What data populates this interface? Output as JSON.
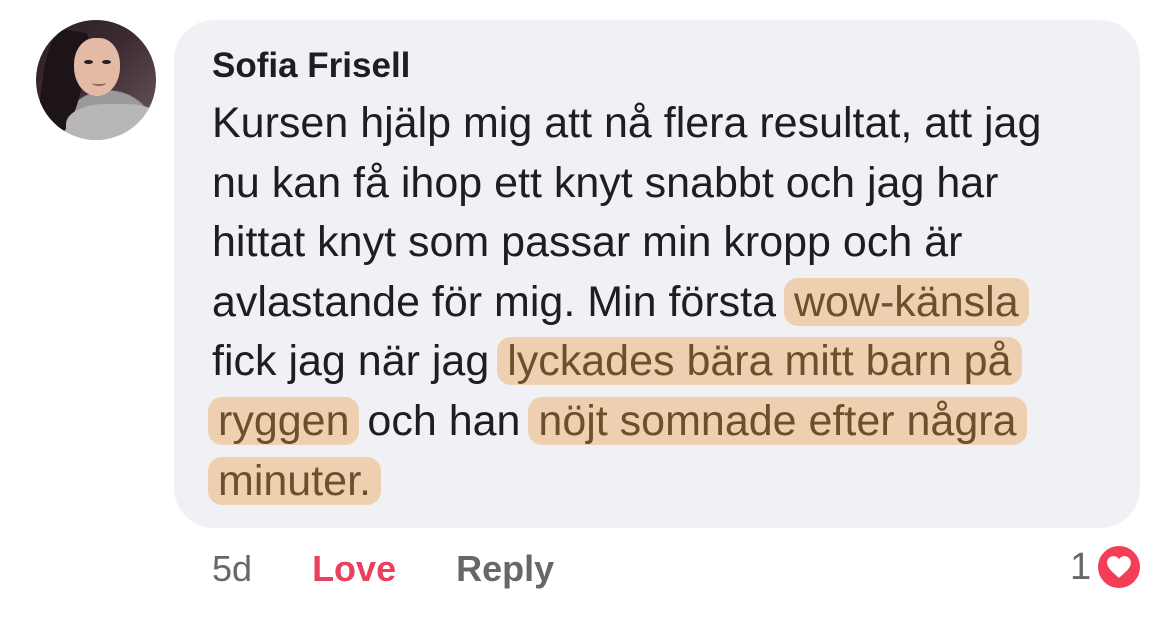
{
  "comment": {
    "author": "Sofia Frisell",
    "lines": [
      [
        {
          "t": "Kursen hjälp mig att nå flera resultat, att jag",
          "h": false
        }
      ],
      [
        {
          "t": "nu kan få ihop ett knyt snabbt och jag har",
          "h": false
        }
      ],
      [
        {
          "t": "hittat knyt som passar min kropp och är",
          "h": false
        }
      ],
      [
        {
          "t": "avlastande för mig. Min första ",
          "h": false
        },
        {
          "t": "wow-känsla",
          "h": true
        }
      ],
      [
        {
          "t": "fick jag när jag ",
          "h": false
        },
        {
          "t": "lyckades bära mitt barn på",
          "h": true
        }
      ],
      [
        {
          "t": "ryggen",
          "h": true
        },
        {
          "t": " och han ",
          "h": false
        },
        {
          "t": "nöjt somnade efter några",
          "h": true
        }
      ],
      [
        {
          "t": "minuter.",
          "h": true
        }
      ]
    ],
    "highlight_color": "#ecb278"
  },
  "actions": {
    "time": "5d",
    "love_label": "Love",
    "reply_label": "Reply",
    "love_color": "#e9405e"
  },
  "reactions": {
    "count": "1",
    "icon": "heart-icon",
    "color": "#f33e58"
  }
}
